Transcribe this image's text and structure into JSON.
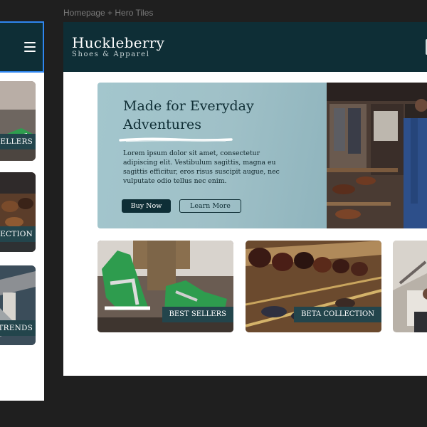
{
  "frame_label": "Homepage + Hero Tiles",
  "mobile": {
    "tiles": [
      {
        "label": "SELLERS"
      },
      {
        "label": "ECTION"
      },
      {
        "label": "TRENDS"
      }
    ]
  },
  "header": {
    "brand_name": "Huckleberry",
    "brand_tagline": "Shoes & Apparel"
  },
  "hero": {
    "title": "Made for Everyday Adventures",
    "body": "Lorem ipsum dolor sit amet, consectetur adipiscing elit. Vestibulum sagittis, magna eu sagittis efficitur, eros risus suscipit augue, nec vulputate odio tellus nec enim.",
    "primary_button": "Buy Now",
    "secondary_button": "Learn More"
  },
  "tiles": [
    {
      "label": "BEST SELLERS"
    },
    {
      "label": "BETA COLLECTION"
    },
    {
      "label": ""
    }
  ],
  "colors": {
    "canvas": "#1f1f1f",
    "header": "#0e2e36",
    "hero_panel": "#a3c6cd",
    "tile_label_bg": "#23454c",
    "selection": "#2f86f0"
  }
}
